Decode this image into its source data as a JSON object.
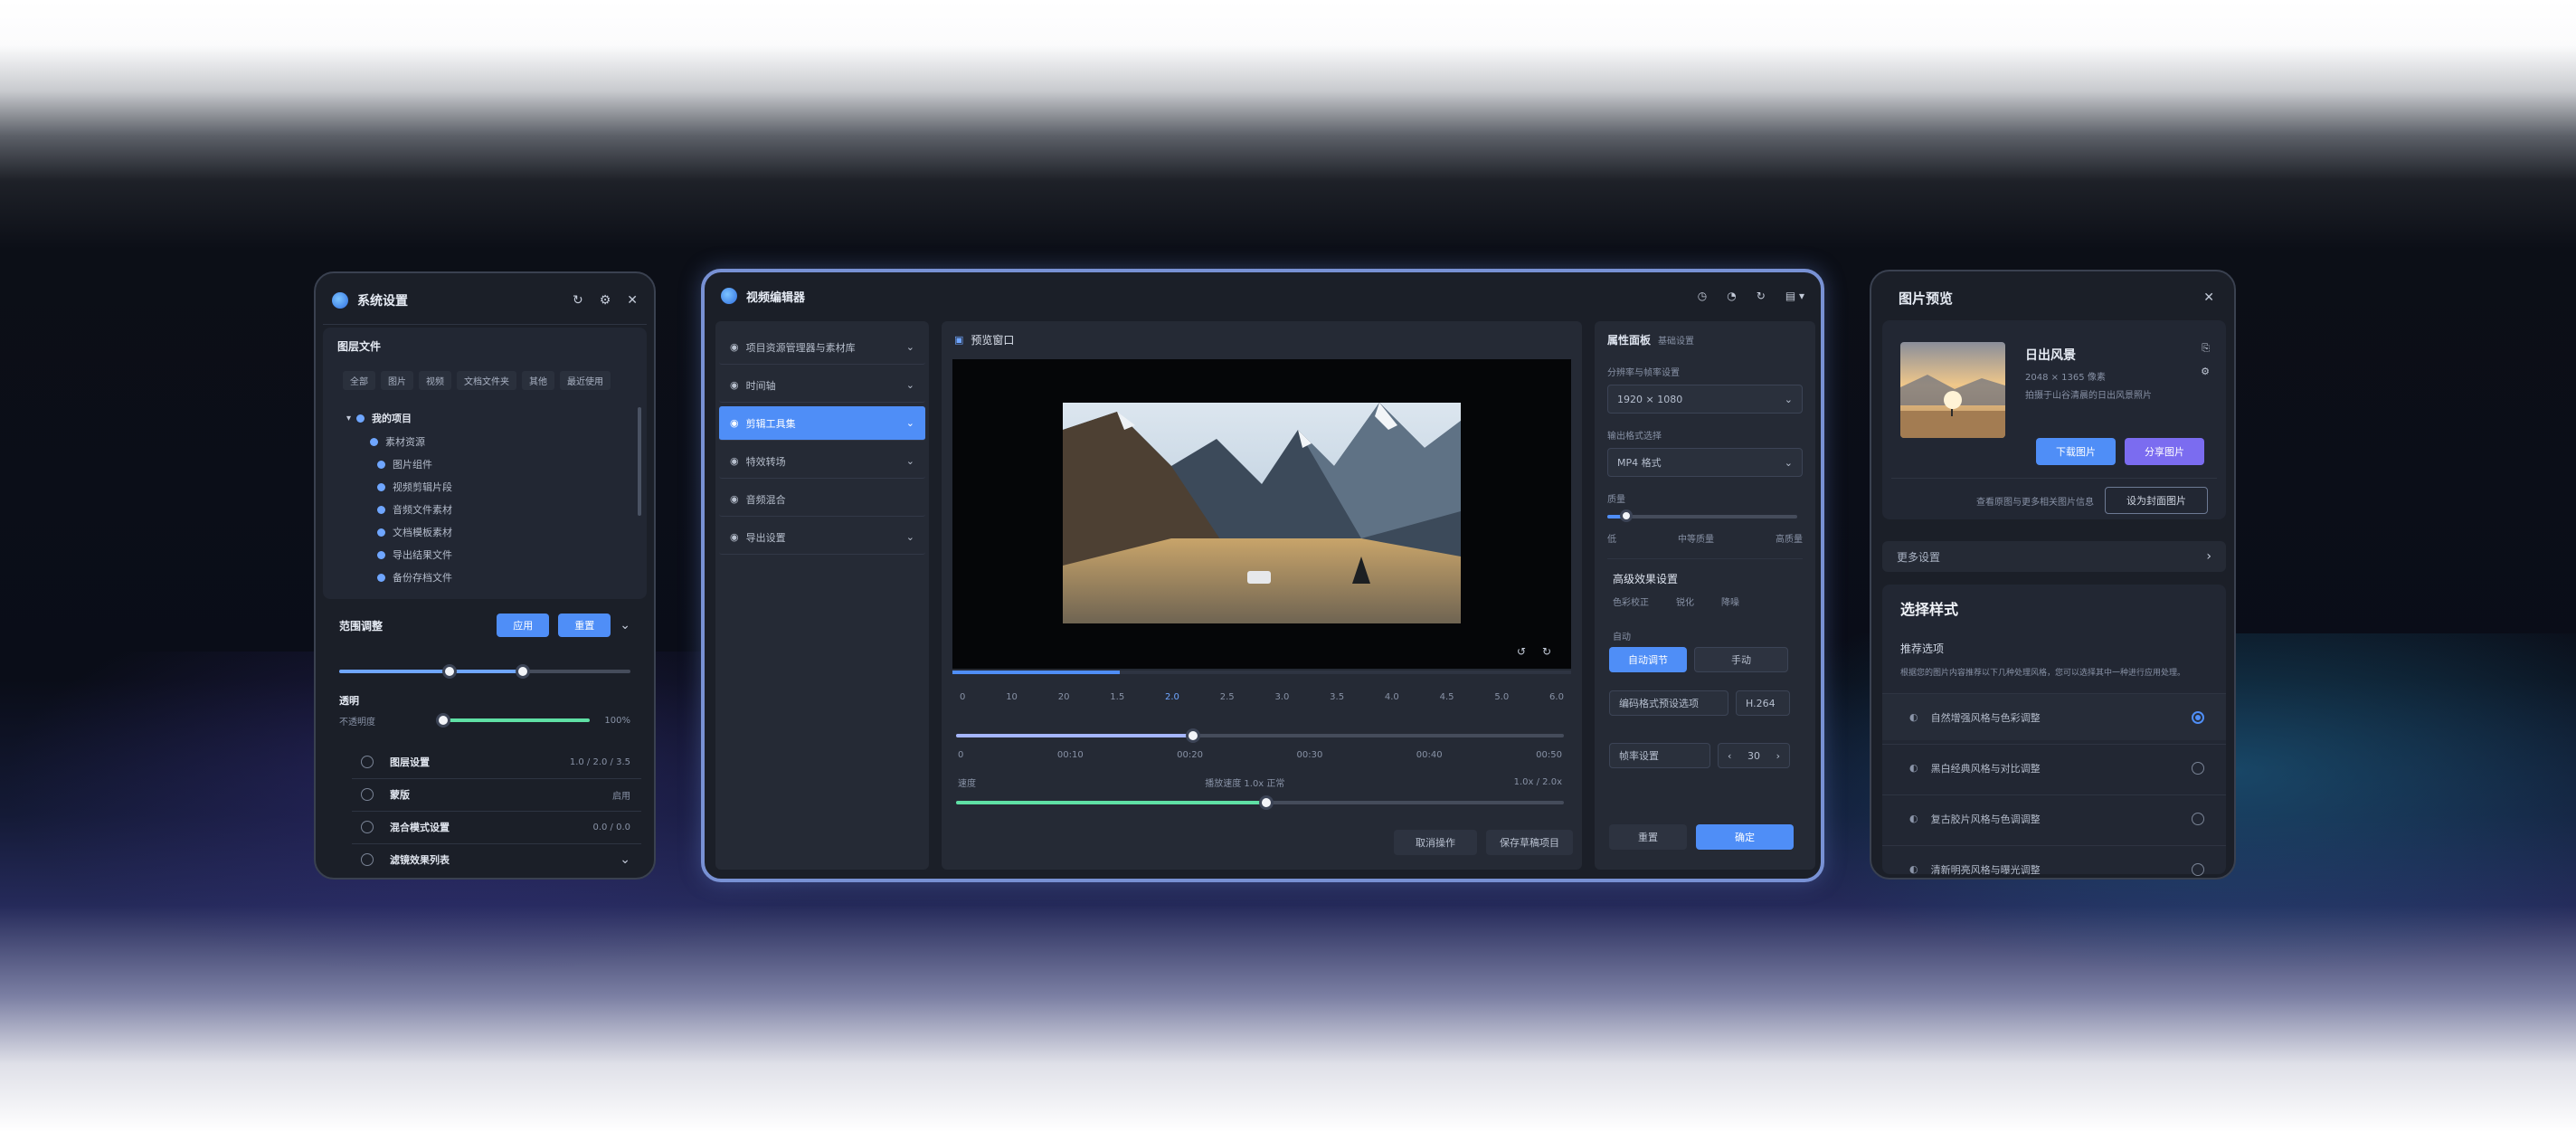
{
  "left_panel": {
    "title": "系统设置",
    "section_title": "图层文件",
    "chips": [
      "全部",
      "图片",
      "视频",
      "文档文件夹",
      "其他",
      "最近使用"
    ],
    "tree_root": "我的项目",
    "tree_items": [
      "素材资源",
      "图片组件",
      "视频剪辑片段",
      "音频文件素材",
      "文档模板素材",
      "导出结果文件",
      "备份存档文件"
    ],
    "range_label": "范围调整",
    "range_btn1": "应用",
    "range_btn2": "重置",
    "range_value": 0.38,
    "range_value2": 0.63,
    "opacity_label": "透明",
    "opacity_sub": "不透明度",
    "opacity_value_text": "100%",
    "opacity_value": 0.0,
    "rows": [
      {
        "label": "图层设置",
        "value": "1.0 / 2.0 / 3.5"
      },
      {
        "label": "蒙版",
        "value": "启用"
      },
      {
        "label": "混合模式设置",
        "value": "0.0 / 0.0"
      },
      {
        "label": "滤镜效果列表",
        "value": ""
      }
    ]
  },
  "main_panel": {
    "title": "视频编辑器",
    "sidebar": [
      {
        "label": "项目资源管理器与素材库",
        "active": false
      },
      {
        "label": "时间轴",
        "active": false
      },
      {
        "label": "剪辑工具集",
        "active": true
      },
      {
        "label": "特效转场",
        "active": false
      },
      {
        "label": "音频混合",
        "active": false
      },
      {
        "label": "导出设置",
        "active": false
      }
    ],
    "preview_title": "预览窗口",
    "playback_progress": 0.27,
    "timeline_ticks": [
      "0",
      "10",
      "20",
      "1.5",
      "2.0",
      "2.5",
      "3.0",
      "3.5",
      "4.0",
      "4.5",
      "5.0",
      "6.0"
    ],
    "scrub_value": 0.39,
    "scale_labels": [
      "0",
      "00:10",
      "00:20",
      "00:30",
      "00:40",
      "00:50"
    ],
    "speed_label_left": "速度",
    "speed_label_mid": "播放速度 1.0x 正常",
    "speed_label_right": "1.0x / 2.0x",
    "speed_value": 0.51,
    "footer_btn1": "取消操作",
    "footer_btn2": "保存草稿项目",
    "props_title": "属性面板",
    "props_sub": "基础设置",
    "field1_label": "分辨率与帧率设置",
    "field1_value": "1920 × 1080",
    "field2_label": "输出格式选择",
    "field2_value": "MP4 格式",
    "slider_label": "质量",
    "slider_marks": [
      "低",
      "中等质量",
      "高质量"
    ],
    "effects_title": "高级效果设置",
    "effects_a": "色彩校正",
    "effects_b": "锐化",
    "effects_c": "降噪",
    "toggle_label": "自动",
    "toggle_on": "自动调节",
    "toggle_off": "手动",
    "select_a": "编码格式预设选项",
    "select_b": "H.264",
    "counter_label": "帧率设置",
    "counter_value": "30",
    "props_btn_cancel": "重置",
    "props_btn_ok": "确定"
  },
  "right_panel": {
    "title": "图片预览",
    "file_name": "日出风景",
    "file_meta1": "2048 × 1365 像素",
    "file_meta2": "拍摄于山谷清晨的日出风景照片",
    "btn_primary": "下载图片",
    "btn_secondary": "分享图片",
    "link_text": "查看原图与更多相关图片信息",
    "btn_outline": "设为封面图片",
    "collapsed_label": "更多设置",
    "section_title": "选择样式",
    "sub_title": "推荐选项",
    "description": "根据您的图片内容推荐以下几种处理风格，您可以选择其中一种进行应用处理。",
    "options": [
      {
        "label": "自然增强风格与色彩调整",
        "selected": true
      },
      {
        "label": "黑白经典风格与对比调整",
        "selected": false
      },
      {
        "label": "复古胶片风格与色调调整",
        "selected": false
      },
      {
        "label": "清新明亮风格与曝光调整",
        "selected": false
      }
    ]
  },
  "colors": {
    "accent": "#4f8ef7",
    "accent2": "#7b6cf0",
    "green": "#5fe0a5",
    "panel": "#1b1f28"
  }
}
